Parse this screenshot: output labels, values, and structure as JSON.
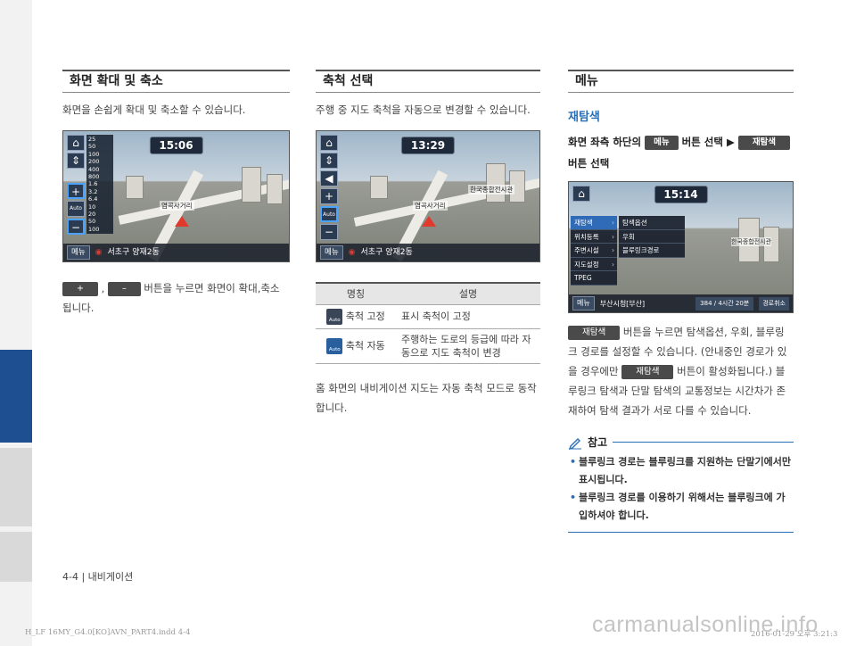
{
  "col1": {
    "title": "화면 확대 및 축소",
    "intro": "화면을 손쉽게 확대 및 축소할 수 있습니다.",
    "screen": {
      "time": "15:06",
      "menu": "메뉴",
      "location": "서초구 양재2동",
      "place": "염곡사거리",
      "scales": [
        "25",
        "50",
        "100",
        "200",
        "400",
        "800",
        "1.6",
        "3.2",
        "6.4",
        "10",
        "20",
        "50",
        "100"
      ],
      "auto_label": "Auto"
    },
    "plus_label": "+",
    "minus_label": "–",
    "sep": ",",
    "instruction_a": "버튼을 누르면 화면이 확대,축소",
    "instruction_b": "됩니다."
  },
  "col2": {
    "title": "축척 선택",
    "intro": "주행 중 지도 축척을 자동으로 변경할 수 있습니다.",
    "screen": {
      "time": "13:29",
      "menu": "메뉴",
      "location": "서초구 양재2동",
      "place": "염곡사거리",
      "place2": "한국종합전시관",
      "auto_label": "Auto"
    },
    "table": {
      "headers": [
        "명칭",
        "설명"
      ],
      "rows": [
        {
          "name": "축척 고정",
          "desc": "표시 축척이 고정"
        },
        {
          "name": "축척 자동",
          "desc": "주행하는 도로의 등급에 따라 자동으로 지도 축척이 변경"
        }
      ]
    },
    "footer_text": "홈 화면의 내비게이션 지도는 자동 축척 모드로 동작합니다."
  },
  "col3": {
    "title": "메뉴",
    "subtitle": "재탐색",
    "step_a": "화면 좌측 하단의",
    "chip_menu": "메뉴",
    "step_b": "버튼 선택",
    "step_arrow": "▶",
    "chip_research": "재탐색",
    "step_c": "버튼 선택",
    "screen": {
      "time": "15:14",
      "menu_items": [
        "재탐색",
        "위치등록",
        "주변시설",
        "지도설정",
        "TPEG"
      ],
      "sub_items": [
        "탐색옵션",
        "우회",
        "블루링크경로"
      ],
      "bottom_menu": "메뉴",
      "bottom_text": "부산시청[부산]",
      "distance": "384 / 4시간 20분",
      "cancel": "경로취소",
      "place": "한국종합전시관"
    },
    "body1": "버튼을 누르면 탐색옵션, 우회, 블루링크 경로를 설정할 수 있습니다. (안내중인 경로가 있을 경우에만",
    "chip_research2": "재탐색",
    "body2": "버튼이 활성화됩니다.) 블루링크 탐색과 단말 탐색의 교통정보는 시간차가 존재하여 탐색 결과가 서로 다를 수 있습니다.",
    "note_title": "참고",
    "notes": [
      "블루링크 경로는 블루링크를 지원하는 단말기에서만 표시됩니다.",
      "블루링크 경로를 이용하기 위해서는 블루링크에 가입하셔야 합니다."
    ]
  },
  "footer": {
    "page": "4-4 | 내비게이션",
    "print_info": "H_LF 16MY_G4.0[KO]AVN_PART4.indd   4-4",
    "print_time": "2016-01-29   오후 3:21:3",
    "watermark": "carmanualsonline.info"
  },
  "colors": {
    "accent_blue": "#2a6fb5",
    "tab_blue": "#1d4f91"
  }
}
